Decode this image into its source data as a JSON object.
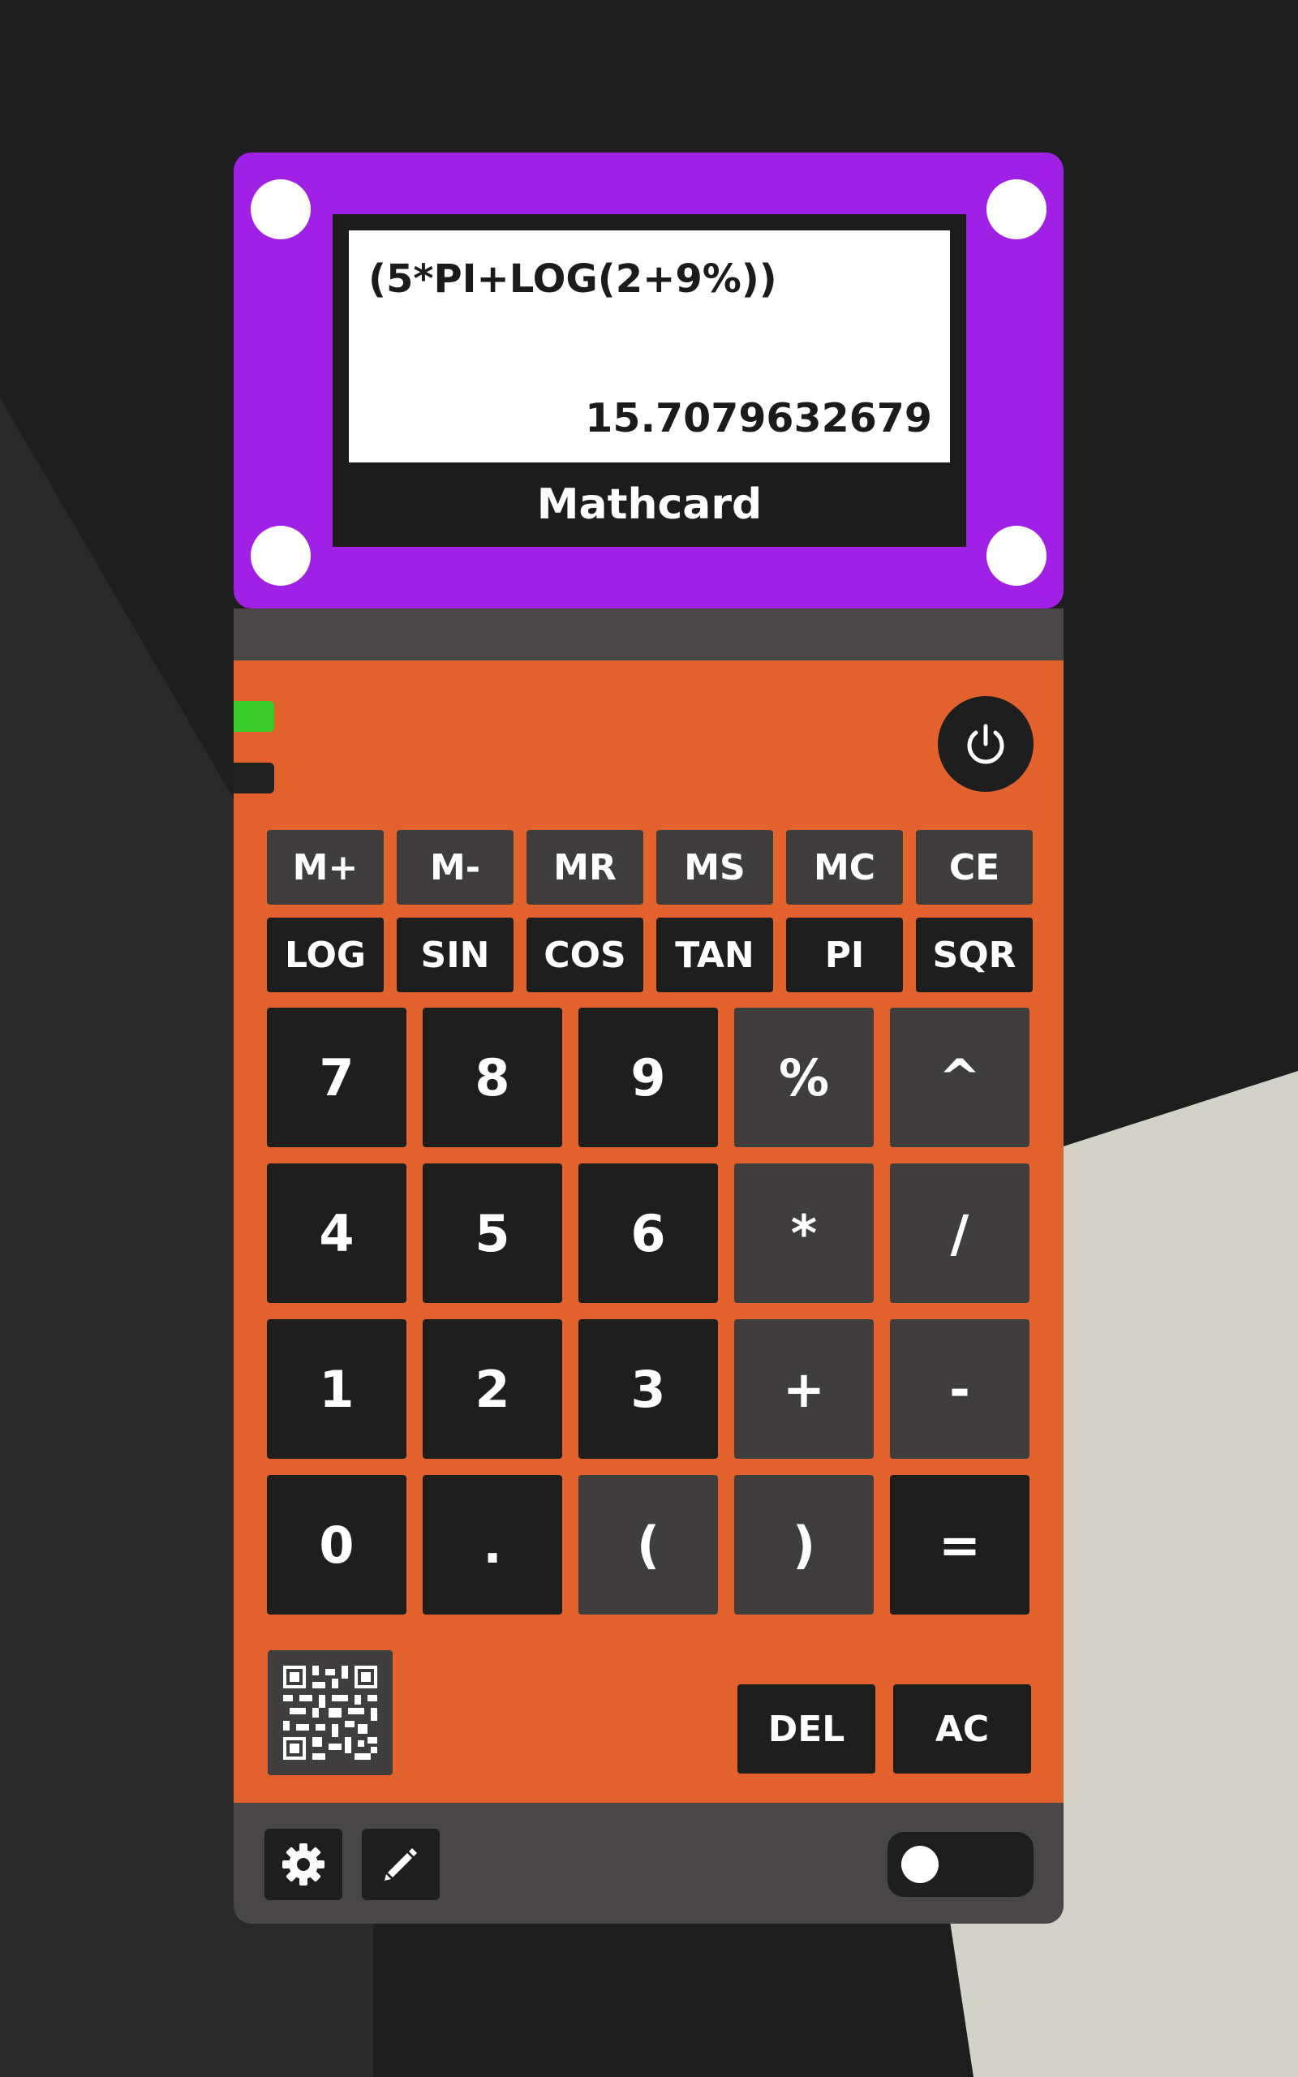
{
  "display": {
    "expression": "(5*PI+LOG(2+9%))",
    "result": "15.7079632679",
    "brand": "Mathcard"
  },
  "memory_row": [
    "M+",
    "M-",
    "MR",
    "MS",
    "MC",
    "CE"
  ],
  "function_row": [
    "LOG",
    "SIN",
    "COS",
    "TAN",
    "PI",
    "SQR"
  ],
  "keypad": [
    [
      "7",
      "8",
      "9",
      "%",
      "^"
    ],
    [
      "4",
      "5",
      "6",
      "*",
      "/"
    ],
    [
      "1",
      "2",
      "3",
      "+",
      "-"
    ],
    [
      "0",
      ".",
      "(",
      ")",
      "="
    ]
  ],
  "actions": {
    "del": "DEL",
    "ac": "AC"
  },
  "icons": {
    "power": "power-icon",
    "qr": "qr-code-icon",
    "settings": "gear-icon",
    "edit": "pencil-icon"
  },
  "colors": {
    "top_panel": "#a020e6",
    "body": "#e2612c",
    "led_on": "#39cc2b",
    "key_dark": "#1e1e1e",
    "key_gray": "#3f3d3d"
  },
  "toggle": {
    "on": false
  }
}
